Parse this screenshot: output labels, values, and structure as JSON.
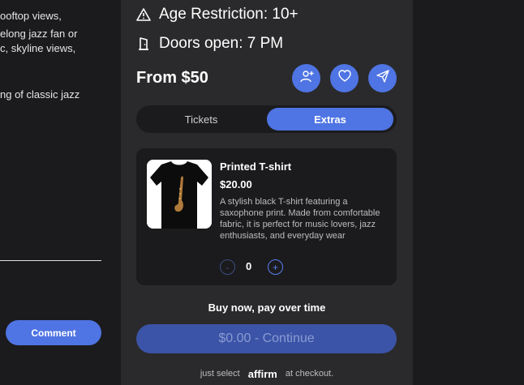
{
  "description": {
    "lines": [
      "ooftop views,",
      "elong jazz fan or",
      "c, skyline views,",
      "ng of classic jazz"
    ]
  },
  "comment": {
    "button_label": "Comment"
  },
  "event": {
    "age_restriction": "Age Restriction: 10+",
    "doors_open": "Doors open: 7 PM",
    "price_from": "From $50"
  },
  "actions": {
    "icons": [
      "add-user-icon",
      "heart-icon",
      "send-icon"
    ]
  },
  "tabs": [
    "Tickets",
    "Extras"
  ],
  "active_tab": "Extras",
  "extra": {
    "name": "Printed T-shirt",
    "price": "$20.00",
    "description": "A stylish black T-shirt featuring a saxophone print. Made from comfortable fabric, it is perfect for music lovers, jazz enthusiasts, and everyday wear",
    "quantity": "0",
    "minus_label": "-",
    "plus_label": "+"
  },
  "checkout": {
    "buy_now": "Buy now, pay over time",
    "continue_label": "$0.00 - Continue",
    "affirm_prefix": "just select",
    "affirm_brand": "affirm",
    "affirm_suffix": "at checkout."
  },
  "colors": {
    "accent": "#4f74e3",
    "panel": "#2a2a2c",
    "background": "#1b1b1d"
  }
}
